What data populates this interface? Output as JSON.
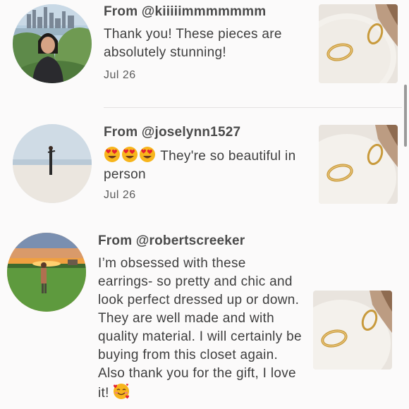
{
  "reviews": [
    {
      "author": "From @kiiiiimmmmmmm",
      "message": "Thank you! These pieces are absolutely stunning!",
      "date": "Jul 26"
    },
    {
      "author": "From @joselynn1527",
      "emoji": "heart-eyes x3",
      "message": "They're so beautiful in person",
      "date": "Jul 26"
    },
    {
      "author": "From @robertscreeker",
      "message": "I’m obsessed with these earrings- so pretty and chic and look perfect dressed up or down. They are well made and with quality material. I will certainly be buying from this closet again. Also thank you for the gift, I love it!",
      "trailing_emoji": "smiling-face-with-hearts"
    }
  ],
  "colors": {
    "background": "#fbfafa",
    "text": "#3e3e3e",
    "emoji_face": "#f7b51c",
    "emoji_heart": "#e5202e"
  }
}
